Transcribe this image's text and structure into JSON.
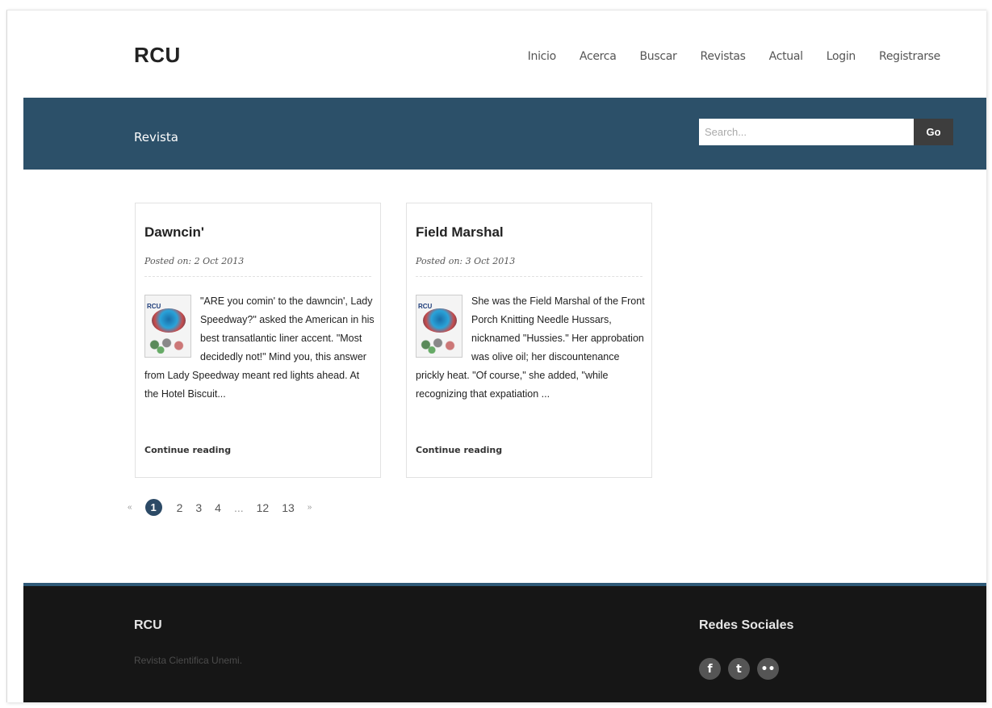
{
  "header": {
    "brand": "RCU",
    "nav": [
      "Inicio",
      "Acerca",
      "Buscar",
      "Revistas",
      "Actual",
      "Login",
      "Registrarse"
    ]
  },
  "banner": {
    "title": "Revista",
    "search_placeholder": "Search...",
    "go_label": "Go"
  },
  "posts": [
    {
      "title": "Dawncin'",
      "date": "Posted on: 2 Oct 2013",
      "excerpt": "\"ARE you comin' to the dawncin', Lady Speedway?\" asked the American in his best transatlantic liner accent. \"Most decidedly not!\" Mind you, this answer from Lady Speedway meant red lights ahead. At the Hotel Biscuit...",
      "more": "Continue reading",
      "thumb_label": "RCU"
    },
    {
      "title": "Field Marshal",
      "date": "Posted on: 3 Oct 2013",
      "excerpt": "She was the Field Marshal of the Front Porch Knitting Needle Hussars, nicknamed \"Hussies.\" Her approbation was olive oil; her discountenance prickly heat. \"Of course,\" she added, \"while recognizing that expatiation ...",
      "more": "Continue reading",
      "thumb_label": "RCU"
    }
  ],
  "pagination": {
    "prev": "«",
    "current": "1",
    "pages": [
      "2",
      "3",
      "4"
    ],
    "ellipsis": "...",
    "last_pages": [
      "12",
      "13"
    ],
    "next": "»"
  },
  "footer": {
    "brand": "RCU",
    "tagline": "Revista Cientifica Unemi.",
    "social_title": "Redes Sociales",
    "social_icons": [
      "facebook-icon",
      "twitter-icon",
      "flickr-icon"
    ]
  }
}
